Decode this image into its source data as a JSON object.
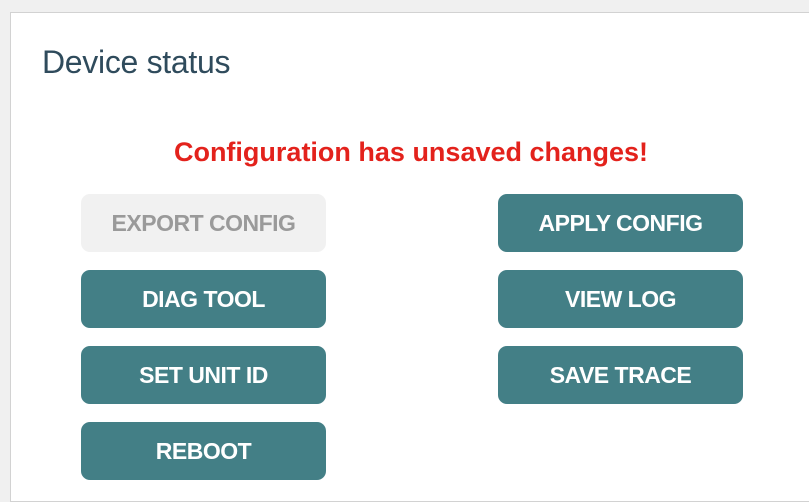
{
  "panel": {
    "title": "Device status",
    "warning": "Configuration has unsaved changes!"
  },
  "buttons": {
    "export_config": "EXPORT CONFIG",
    "apply_config": "APPLY CONFIG",
    "diag_tool": "DIAG TOOL",
    "view_log": "VIEW LOG",
    "set_unit_id": "SET UNIT ID",
    "save_trace": "SAVE TRACE",
    "reboot": "REBOOT"
  },
  "colors": {
    "button_bg": "#437f86",
    "button_disabled_bg": "#f1f1f1",
    "warning": "#e3221c",
    "title": "#2f4b5c"
  }
}
